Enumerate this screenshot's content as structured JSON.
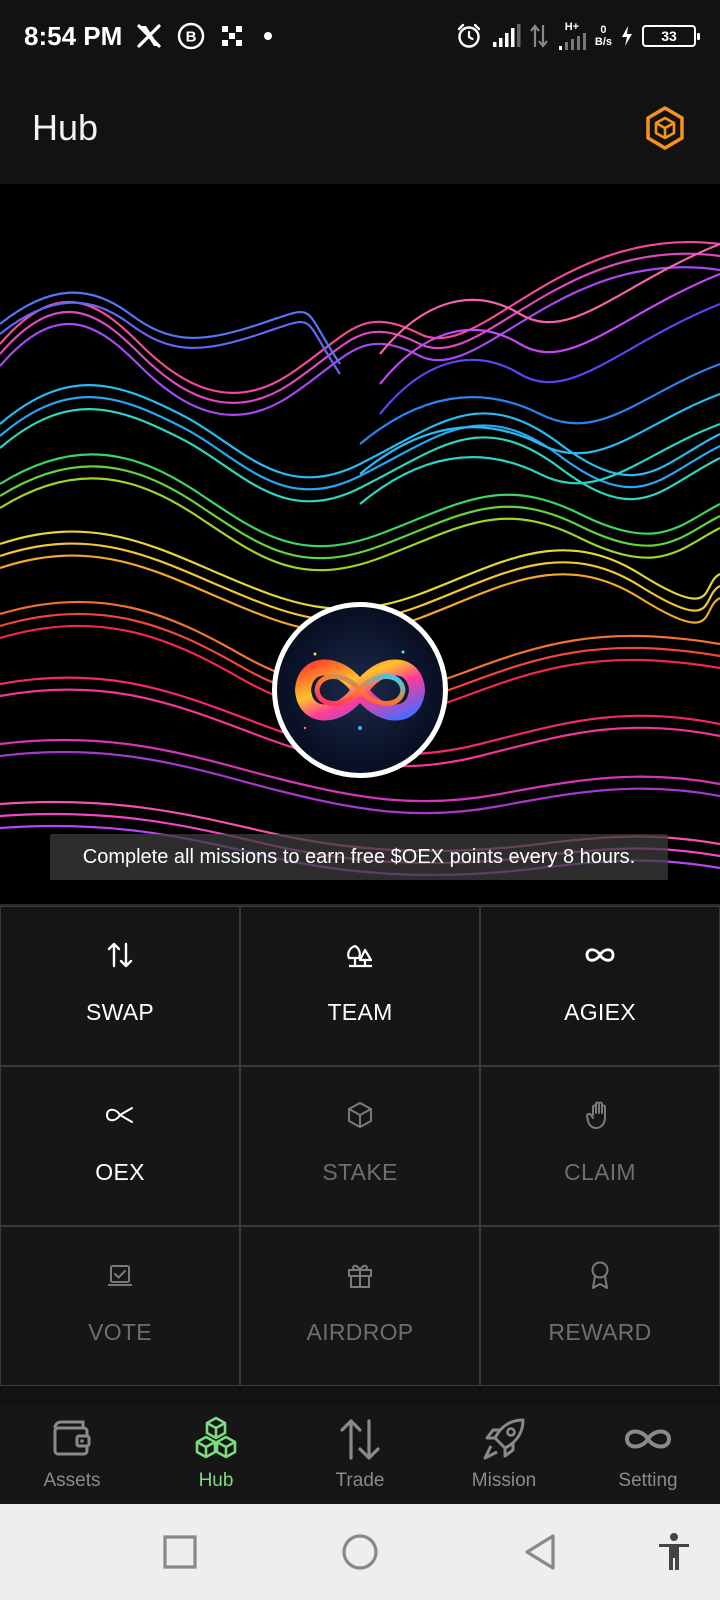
{
  "status_bar": {
    "time": "8:54 PM",
    "net_speed_value": "0",
    "net_speed_unit": "B/s",
    "network_type": "H+",
    "battery_level": "33"
  },
  "header": {
    "title": "Hub"
  },
  "banner": {
    "caption": "Complete all missions to earn free $OEX points every 8 hours."
  },
  "menu": {
    "items": [
      {
        "label": "SWAP",
        "icon": "swap-arrows-icon",
        "state": "active"
      },
      {
        "label": "TEAM",
        "icon": "team-trees-icon",
        "state": "active"
      },
      {
        "label": "AGIEX",
        "icon": "infinity-icon",
        "state": "active"
      },
      {
        "label": "OEX",
        "icon": "oex-loop-icon",
        "state": "active"
      },
      {
        "label": "STAKE",
        "icon": "cube-icon",
        "state": "disabled"
      },
      {
        "label": "CLAIM",
        "icon": "hand-icon",
        "state": "disabled"
      },
      {
        "label": "VOTE",
        "icon": "ballot-icon",
        "state": "disabled"
      },
      {
        "label": "AIRDROP",
        "icon": "gift-icon",
        "state": "disabled"
      },
      {
        "label": "REWARD",
        "icon": "award-icon",
        "state": "disabled"
      }
    ]
  },
  "bottom_nav": {
    "items": [
      {
        "label": "Assets",
        "icon": "wallet-icon"
      },
      {
        "label": "Hub",
        "icon": "cubes-icon",
        "selected": true
      },
      {
        "label": "Trade",
        "icon": "trade-arrows-icon"
      },
      {
        "label": "Mission",
        "icon": "rocket-icon"
      },
      {
        "label": "Setting",
        "icon": "infinity-icon"
      }
    ]
  },
  "colors": {
    "background": "#121212",
    "accent_green": "#7ddc7f",
    "accent_orange": "#f7931a",
    "disabled_text": "#6e6e6e"
  }
}
